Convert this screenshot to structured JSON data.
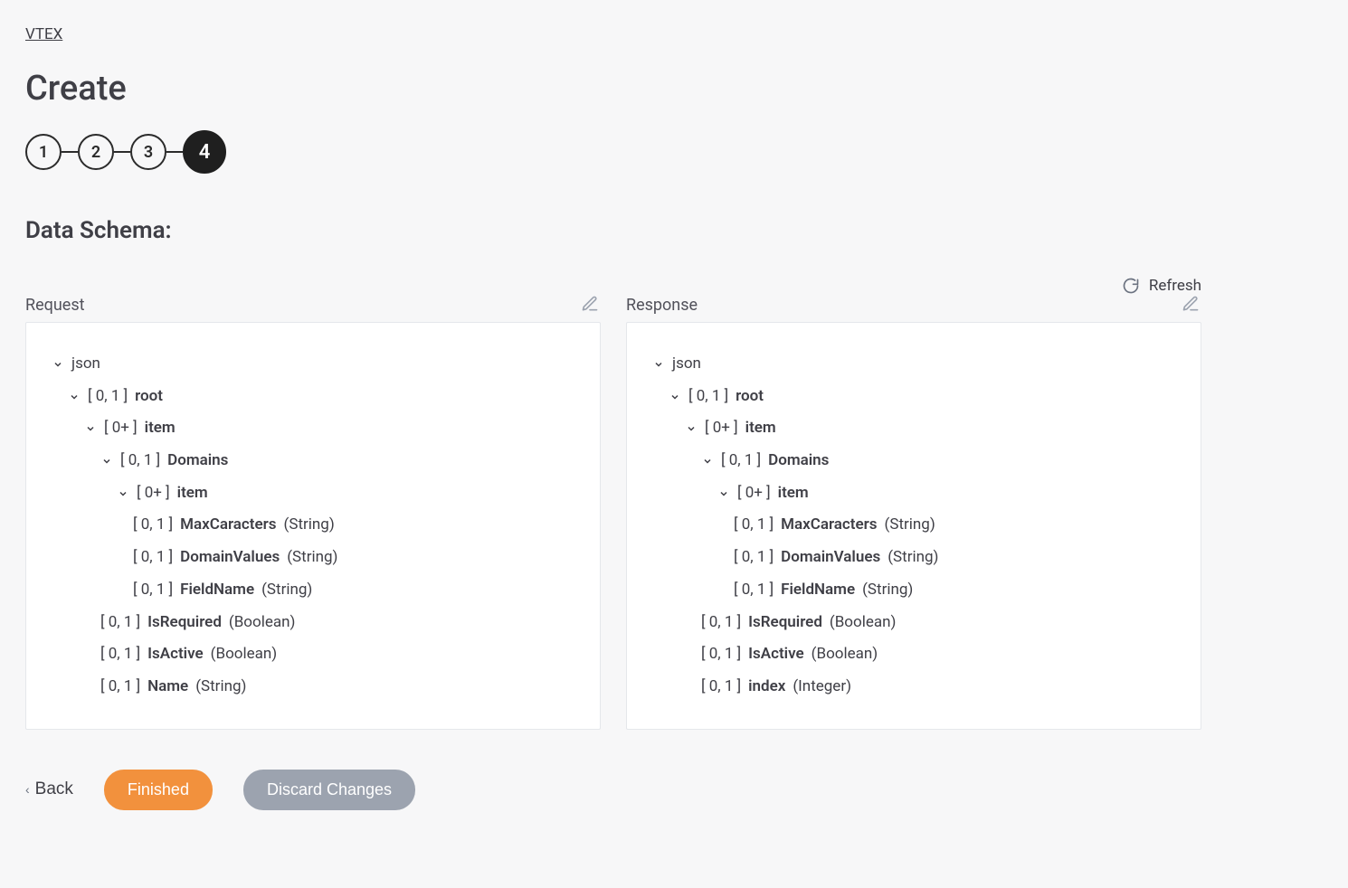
{
  "breadcrumb": "VTEX",
  "page_title": "Create",
  "stepper": {
    "steps": [
      "1",
      "2",
      "3",
      "4"
    ],
    "active_index": 3
  },
  "section_title": "Data Schema:",
  "refresh_label": "Refresh",
  "panels": {
    "request": {
      "label": "Request",
      "tree": {
        "root_label": "json",
        "r_root": {
          "card": "[ 0, 1 ]",
          "name": "root"
        },
        "r_item1": {
          "card": "[ 0+ ]",
          "name": "item"
        },
        "r_domains": {
          "card": "[ 0, 1 ]",
          "name": "Domains"
        },
        "r_item2": {
          "card": "[ 0+ ]",
          "name": "item"
        },
        "f_maxcar": {
          "card": "[ 0, 1 ]",
          "name": "MaxCaracters",
          "type": "(String)"
        },
        "f_domvals": {
          "card": "[ 0, 1 ]",
          "name": "DomainValues",
          "type": "(String)"
        },
        "f_fieldname": {
          "card": "[ 0, 1 ]",
          "name": "FieldName",
          "type": "(String)"
        },
        "f_isreq": {
          "card": "[ 0, 1 ]",
          "name": "IsRequired",
          "type": "(Boolean)"
        },
        "f_isact": {
          "card": "[ 0, 1 ]",
          "name": "IsActive",
          "type": "(Boolean)"
        },
        "f_last": {
          "card": "[ 0, 1 ]",
          "name": "Name",
          "type": "(String)"
        }
      }
    },
    "response": {
      "label": "Response",
      "tree": {
        "root_label": "json",
        "r_root": {
          "card": "[ 0, 1 ]",
          "name": "root"
        },
        "r_item1": {
          "card": "[ 0+ ]",
          "name": "item"
        },
        "r_domains": {
          "card": "[ 0, 1 ]",
          "name": "Domains"
        },
        "r_item2": {
          "card": "[ 0+ ]",
          "name": "item"
        },
        "f_maxcar": {
          "card": "[ 0, 1 ]",
          "name": "MaxCaracters",
          "type": "(String)"
        },
        "f_domvals": {
          "card": "[ 0, 1 ]",
          "name": "DomainValues",
          "type": "(String)"
        },
        "f_fieldname": {
          "card": "[ 0, 1 ]",
          "name": "FieldName",
          "type": "(String)"
        },
        "f_isreq": {
          "card": "[ 0, 1 ]",
          "name": "IsRequired",
          "type": "(Boolean)"
        },
        "f_isact": {
          "card": "[ 0, 1 ]",
          "name": "IsActive",
          "type": "(Boolean)"
        },
        "f_last": {
          "card": "[ 0, 1 ]",
          "name": "index",
          "type": "(Integer)"
        }
      }
    }
  },
  "footer": {
    "back": "Back",
    "finished": "Finished",
    "discard": "Discard Changes"
  }
}
